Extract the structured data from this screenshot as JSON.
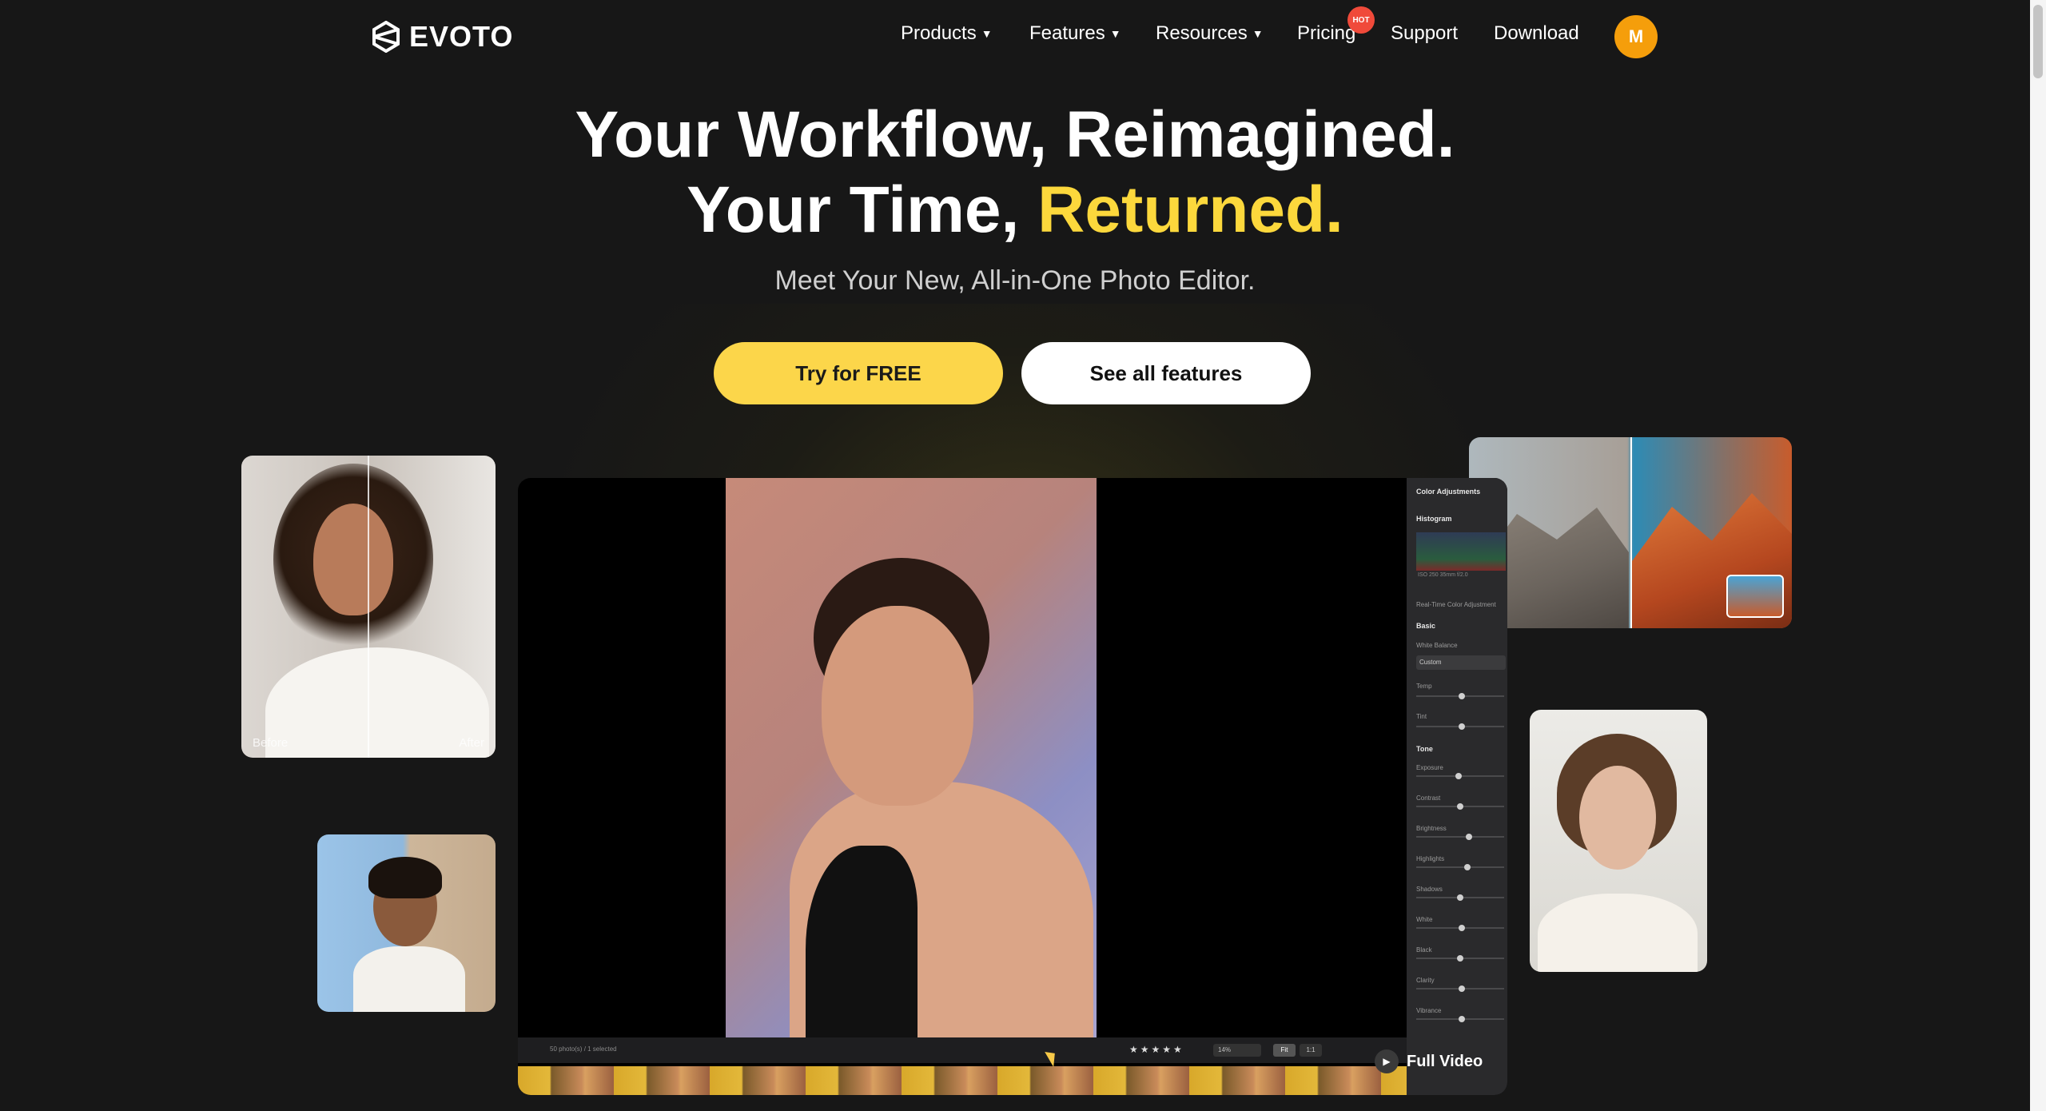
{
  "nav": {
    "logo_text": "EVOTO",
    "items": [
      {
        "label": "Products",
        "dropdown": true
      },
      {
        "label": "Features",
        "dropdown": true
      },
      {
        "label": "Resources",
        "dropdown": true
      },
      {
        "label": "Pricing",
        "dropdown": false
      },
      {
        "label": "Support",
        "dropdown": false
      },
      {
        "label": "Download",
        "dropdown": false
      }
    ],
    "hot_badge": "HOT",
    "avatar_initial": "M"
  },
  "hero": {
    "line1": "Your Workflow, Reimagined.",
    "line2_part1": "Your Time,",
    "line2_highlight": "Returned.",
    "subtitle": "Meet Your New, All-in-One Photo Editor.",
    "cta_primary": "Try for FREE",
    "cta_secondary": "See all features"
  },
  "cards": {
    "before_label": "Before",
    "after_label": "After"
  },
  "editor": {
    "panel_title": "Color Adjustments",
    "histogram_title": "Histogram",
    "histogram_caption": "ISO 250   35mm   f/2.0",
    "realtime_label": "Real-Time Color Adjustment",
    "basic_title": "Basic",
    "white_balance_label": "White Balance",
    "white_balance_value": "Custom",
    "temp_label": "Temp",
    "tint_label": "Tint",
    "tone_title": "Tone",
    "sliders": [
      {
        "label": "Exposure",
        "value": 0.48
      },
      {
        "label": "Contrast",
        "value": 0.5
      },
      {
        "label": "Brightness",
        "value": 0.6
      },
      {
        "label": "Highlights",
        "value": 0.58
      },
      {
        "label": "Shadows",
        "value": 0.5
      },
      {
        "label": "White",
        "value": 0.52
      },
      {
        "label": "Black",
        "value": 0.5
      },
      {
        "label": "Clarity",
        "value": 0.52
      },
      {
        "label": "Vibrance",
        "value": 0.52
      }
    ],
    "temp_value": 0.52,
    "tint_value": 0.52,
    "toolbar_status": "50 photo(s) / 1 selected",
    "rating": "★★★★★",
    "zoom": "14%",
    "fit_label": "Fit",
    "one_to_one_label": "1:1",
    "full_video_label": "Full Video"
  },
  "colors": {
    "accent_yellow": "#fcd83c",
    "avatar_orange": "#f59e0b",
    "hot_red": "#f04a3a",
    "background": "#171717"
  }
}
